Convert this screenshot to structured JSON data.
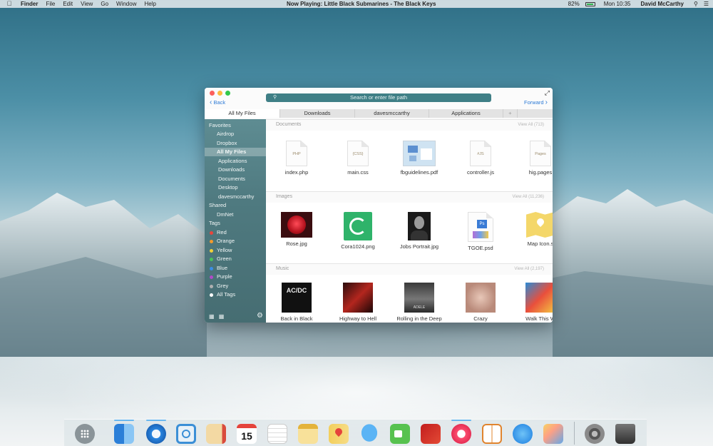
{
  "menubar": {
    "apple_icon": "apple-icon",
    "app": "Finder",
    "menus": [
      "File",
      "Edit",
      "View",
      "Go",
      "Window",
      "Help"
    ],
    "now_playing": "Now Playing: Little Black Submarines - The Black Keys",
    "battery_percent": "82%",
    "battery_level": 0.82,
    "time": "Mon 10:35",
    "user": "David McCarthy"
  },
  "window": {
    "search_placeholder": "Search or enter file path",
    "back_label": "Back",
    "forward_label": "Forward",
    "tabs": [
      "All My Files",
      "Downloads",
      "davesmccarthy",
      "Applications",
      "+"
    ],
    "sidebar": {
      "favorites_header": "Favorites",
      "favorites": [
        "Airdrop",
        "Dropbox",
        "All My Files"
      ],
      "sub_items": [
        "Applications",
        "Downloads",
        "Documents",
        "Desktop",
        "davesmccarthy"
      ],
      "shared_header": "Shared",
      "shared": [
        "DmNet"
      ],
      "tags_header": "Tags",
      "tags": [
        {
          "label": "Red",
          "color": "#e8453c"
        },
        {
          "label": "Orange",
          "color": "#f39a2b"
        },
        {
          "label": "Yellow",
          "color": "#f2d23a"
        },
        {
          "label": "Green",
          "color": "#49c15a"
        },
        {
          "label": "Blue",
          "color": "#3a8ee6"
        },
        {
          "label": "Purple",
          "color": "#b04ac8"
        },
        {
          "label": "Grey",
          "color": "#b0b0b0"
        },
        {
          "label": "All Tags",
          "color": "#ffffff"
        }
      ]
    },
    "sections": {
      "documents": {
        "title": "Documents",
        "view_all": "View All (713)",
        "items": [
          {
            "name": "index.php",
            "badge": "PHP"
          },
          {
            "name": "main.css",
            "badge": "{CSS}"
          },
          {
            "name": "fbguidelines.pdf",
            "badge": ""
          },
          {
            "name": "controller.js",
            "badge": "#JS"
          },
          {
            "name": "hig.pages",
            "badge": "Pages"
          }
        ]
      },
      "images": {
        "title": "Images",
        "view_all": "View All (11,236)",
        "items": [
          "Rose.jpg",
          "Cora1024.png",
          "Jobs Portrait.jpg",
          "TGOE.psd",
          "Map Icon.s"
        ]
      },
      "music": {
        "title": "Music",
        "view_all": "View All (2,197)",
        "items": [
          "Back in Black",
          "Highway to Hell",
          "Rolling in the Deep",
          "Crazy",
          "Walk This W"
        ],
        "album_text": [
          "AC/DC",
          "",
          "ADELE",
          "",
          ""
        ]
      }
    }
  },
  "dock": {
    "apps": [
      "launchpad-icon",
      "finder-icon",
      "safari-icon",
      "mail-icon",
      "contacts-icon",
      "calendar-icon",
      "reminders-icon",
      "notes-icon",
      "maps-icon",
      "messages-icon",
      "facetime-icon",
      "photo-booth-icon",
      "itunes-icon",
      "ibooks-icon",
      "app-store-icon",
      "preview-icon",
      "system-preferences-icon",
      "trash-icon"
    ],
    "calendar_day": "15"
  }
}
